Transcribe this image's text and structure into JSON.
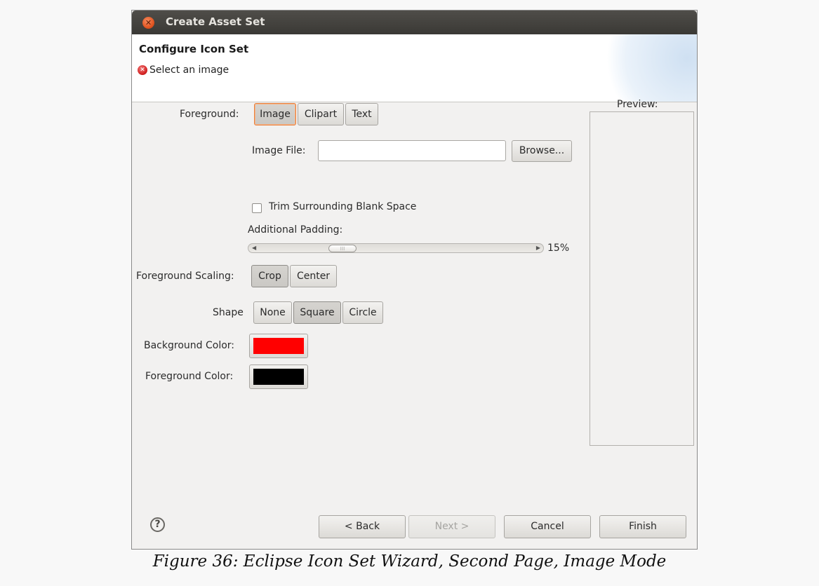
{
  "window": {
    "title": "Create Asset Set"
  },
  "header": {
    "title": "Configure Icon Set",
    "message": "Select an image"
  },
  "foreground": {
    "label": "Foreground:",
    "options": [
      "Image",
      "Clipart",
      "Text"
    ],
    "selected": "Image"
  },
  "image_file": {
    "label": "Image File:",
    "value": "",
    "browse_label": "Browse..."
  },
  "trim": {
    "label": "Trim Surrounding Blank Space",
    "checked": false
  },
  "padding": {
    "label": "Additional Padding:",
    "value_label": "15%",
    "value": 15
  },
  "scaling": {
    "label": "Foreground Scaling:",
    "options": [
      "Crop",
      "Center"
    ],
    "selected": "Crop"
  },
  "shape": {
    "label": "Shape",
    "options": [
      "None",
      "Square",
      "Circle"
    ],
    "selected": "Square"
  },
  "background_color": {
    "label": "Background Color:",
    "color": "#ff0000"
  },
  "foreground_color": {
    "label": "Foreground Color:",
    "color": "#000000"
  },
  "preview": {
    "label": "Preview:"
  },
  "footer": {
    "back_label": "< Back",
    "next_label": "Next >",
    "cancel_label": "Cancel",
    "finish_label": "Finish"
  },
  "icons": {
    "close": "close-icon",
    "error": "error-icon",
    "help": "help-icon"
  },
  "colors": {
    "focus_accent": "#e9803c",
    "close_button": "#e0521e",
    "error": "#d22121"
  },
  "caption": "Figure 36: Eclipse Icon Set Wizard, Second Page, Image Mode"
}
